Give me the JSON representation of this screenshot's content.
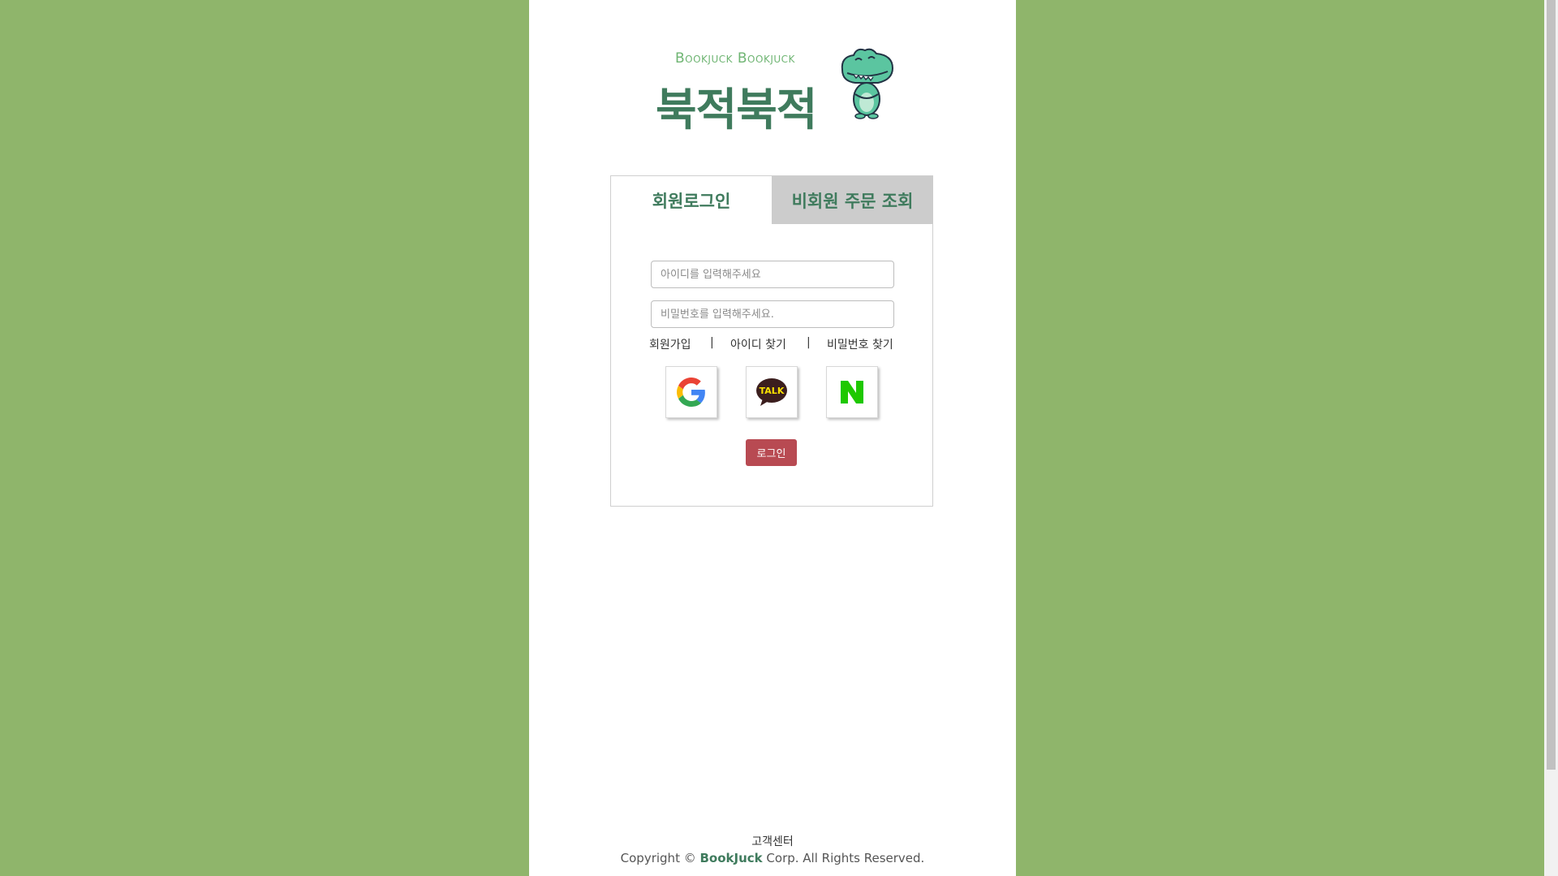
{
  "logo": {
    "subtitle": "Bookjuck Bookjuck",
    "title": "북적북적"
  },
  "tabs": {
    "member_login": "회원로그인",
    "guest_order": "비회원 주문 조회"
  },
  "form": {
    "id_placeholder": "아이디를 입력해주세요",
    "pw_placeholder": "비밀번호를 입력해주세요."
  },
  "links": {
    "join": "회원가입",
    "separator": "|",
    "find_id": "아이디 찾기",
    "find_pw": "비밀번호 찾기"
  },
  "social": {
    "kakao_text": "TALK",
    "naver_text": "N"
  },
  "login_button": "로그인",
  "footer": {
    "customer_center": "고객센터",
    "copy_prefix": "Copyright © ",
    "brand": "BookJuck",
    "copy_suffix": " Corp. All Rights Reserved."
  },
  "colors": {
    "background": "#8fb56b",
    "brand_green": "#3f7b5d",
    "login_button": "#b84a52",
    "inactive_tab": "#cccccc"
  }
}
